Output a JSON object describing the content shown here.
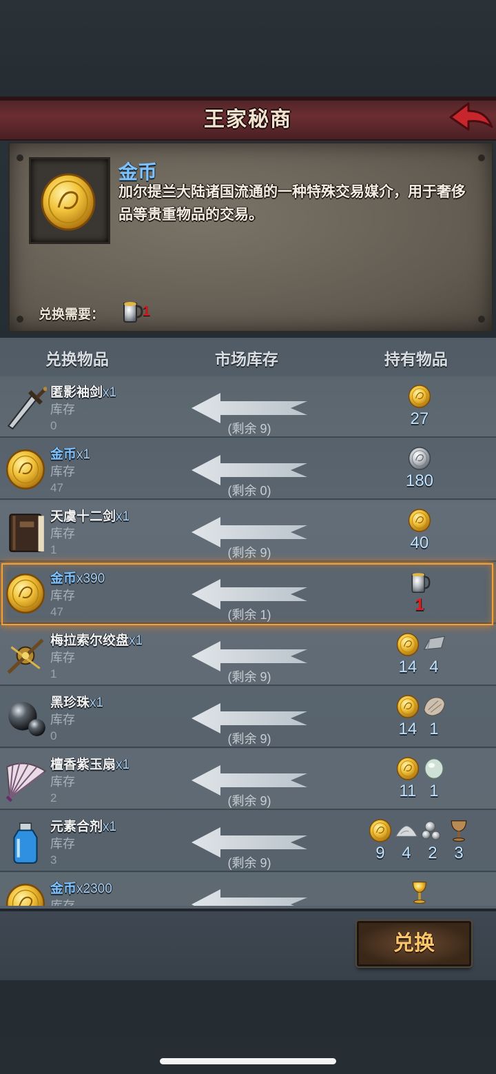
{
  "header": {
    "title": "王家秘商"
  },
  "detail": {
    "name": "金币",
    "description": "加尔提兰大陆诸国流通的一种特殊交易媒介，用于奢侈品等贵重物品的交易。",
    "need_label": "兑换需要：",
    "need_icon": "silver-mug-icon",
    "need_count": "1"
  },
  "columns": {
    "exchange_item": "兑换物品",
    "market_stock": "市场库存",
    "held_items": "持有物品"
  },
  "rows": [
    {
      "name": "匿影袖剑",
      "qty": "x1",
      "stock_label": "库存",
      "stock": "0",
      "remain": "(剩余 9)",
      "icon": "dagger-icon",
      "name_blue": false,
      "reqs": [
        {
          "icon": "gold-coin-icon",
          "count": "27"
        }
      ]
    },
    {
      "name": "金币",
      "qty": "x1",
      "stock_label": "库存",
      "stock": "47",
      "remain": "(剩余 0)",
      "icon": "gold-coin-icon",
      "name_blue": true,
      "reqs": [
        {
          "icon": "silver-coin-icon",
          "count": "180"
        }
      ]
    },
    {
      "name": "天虞十二剑",
      "qty": "x1",
      "stock_label": "库存",
      "stock": "1",
      "remain": "(剩余 9)",
      "icon": "book-icon",
      "name_blue": false,
      "reqs": [
        {
          "icon": "gold-coin-icon",
          "count": "40"
        }
      ]
    },
    {
      "name": "金币",
      "qty": "x390",
      "stock_label": "库存",
      "stock": "47",
      "remain": "(剩余 1)",
      "icon": "gold-coin-icon",
      "name_blue": true,
      "reqs": [
        {
          "icon": "silver-mug-icon",
          "count": "1",
          "red": true
        }
      ]
    },
    {
      "name": "梅拉索尔绞盘",
      "qty": "x1",
      "stock_label": "库存",
      "stock": "1",
      "remain": "(剩余 9)",
      "icon": "winch-icon",
      "name_blue": false,
      "reqs": [
        {
          "icon": "gold-coin-icon",
          "count": "14"
        },
        {
          "icon": "iron-ingot-icon",
          "count": "4"
        }
      ]
    },
    {
      "name": "黑珍珠",
      "qty": "x1",
      "stock_label": "库存",
      "stock": "0",
      "remain": "(剩余 9)",
      "icon": "black-pearl-icon",
      "name_blue": false,
      "reqs": [
        {
          "icon": "gold-coin-icon",
          "count": "14"
        },
        {
          "icon": "fur-pelt-icon",
          "count": "1"
        }
      ]
    },
    {
      "name": "檀香紫玉扇",
      "qty": "x1",
      "stock_label": "库存",
      "stock": "2",
      "remain": "(剩余 9)",
      "icon": "folding-fan-icon",
      "name_blue": false,
      "reqs": [
        {
          "icon": "gold-coin-icon",
          "count": "11"
        },
        {
          "icon": "jade-stone-icon",
          "count": "1"
        }
      ]
    },
    {
      "name": "元素合剂",
      "qty": "x1",
      "stock_label": "库存",
      "stock": "3",
      "remain": "(剩余 9)",
      "icon": "potion-bottle-icon",
      "name_blue": false,
      "reqs": [
        {
          "icon": "gold-coin-icon",
          "count": "9"
        },
        {
          "icon": "salt-pile-icon",
          "count": "4"
        },
        {
          "icon": "pearls-icon",
          "count": "2"
        },
        {
          "icon": "goblet-icon",
          "count": "3"
        }
      ]
    },
    {
      "name": "金币",
      "qty": "x2300",
      "stock_label": "库存",
      "stock": "",
      "remain": "",
      "icon": "gold-coin-icon",
      "name_blue": true,
      "reqs": [
        {
          "icon": "gold-chalice-icon",
          "count": ""
        }
      ]
    }
  ],
  "footer": {
    "exchange_label": "兑换"
  },
  "colors": {
    "title_bar": "#6b2e32",
    "item_name_blue": "#7ec3ff",
    "highlight": "#f0a23a",
    "exchange_gold": "#f8c66a",
    "red_count": "#e01c1c"
  }
}
